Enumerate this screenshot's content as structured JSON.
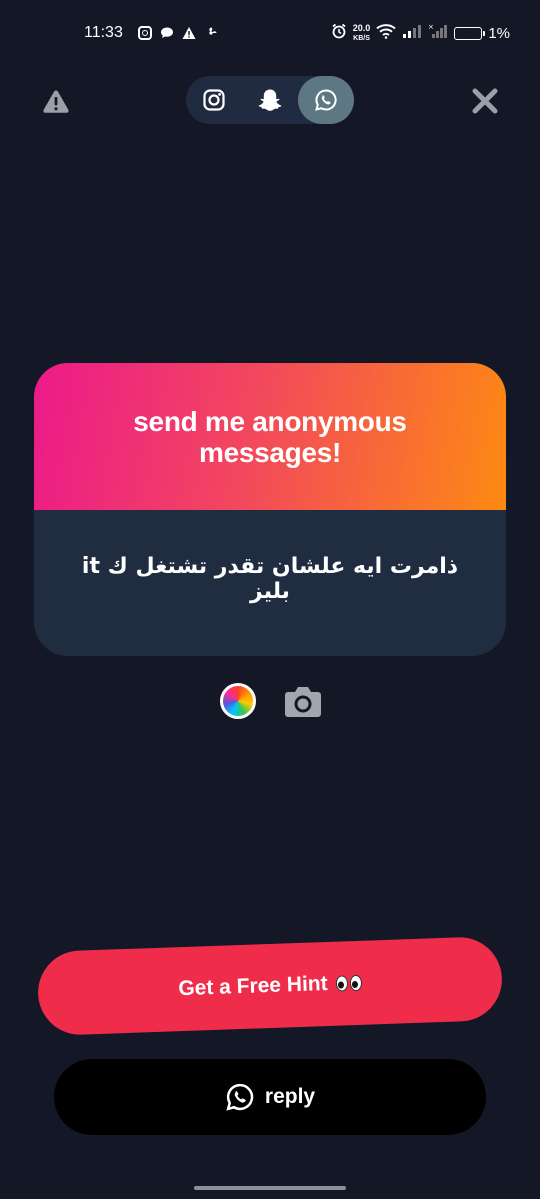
{
  "status_bar": {
    "time": "11:33",
    "net_speed_value": "20.0",
    "net_speed_unit": "KB/S",
    "battery_percent": "1%",
    "icons": [
      "instagram-icon",
      "message-icon",
      "warning-icon",
      "fan-icon",
      "alarm-icon",
      "wifi-icon",
      "signal-icon",
      "signal-icon",
      "battery-icon"
    ]
  },
  "top_bar": {
    "report_icon": "warning-icon",
    "close_icon": "close-icon",
    "share_options": [
      {
        "name": "instagram",
        "icon": "instagram-icon",
        "selected": false
      },
      {
        "name": "snapchat",
        "icon": "snapchat-icon",
        "selected": false
      },
      {
        "name": "whatsapp",
        "icon": "whatsapp-icon",
        "selected": true
      }
    ]
  },
  "card": {
    "title": "send me anonymous messages!",
    "message": "ذامرت ايه علشان تقدر تشتغل ك it بليز"
  },
  "tools": {
    "color_icon": "color-wheel-icon",
    "camera_icon": "camera-icon"
  },
  "buttons": {
    "hint_label": "Get a Free Hint",
    "hint_emoji": "eyes-icon",
    "reply_label": "reply",
    "reply_icon": "whatsapp-icon"
  },
  "colors": {
    "background": "#141826",
    "card_gradient_start": "#ec1a8a",
    "card_gradient_end": "#fd8a12",
    "card_body": "#202c3f",
    "hint_button": "#ef2d4b",
    "reply_button": "#000000",
    "selected_share": "#5e7883"
  }
}
